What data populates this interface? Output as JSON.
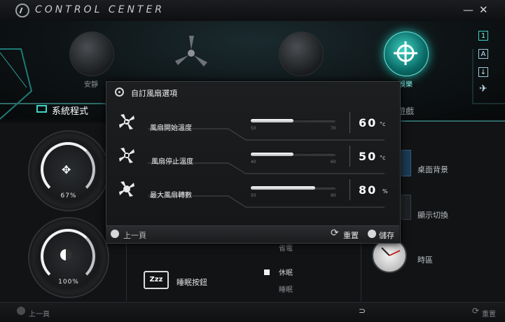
{
  "window": {
    "title": "CONTROL CENTER",
    "minimize": "—",
    "close": "✕"
  },
  "modes": [
    {
      "label": "安靜",
      "icon": "speaker-icon"
    },
    {
      "label": "",
      "icon": "fan-icon"
    },
    {
      "label": "",
      "icon": "speedometer-icon"
    },
    {
      "label": "娛樂",
      "icon": "crosshair-icon"
    }
  ],
  "side_icons": [
    "1",
    "A",
    "↓",
    "✈"
  ],
  "tabs": {
    "system": "系統程式",
    "game": "遊戲"
  },
  "dials": [
    {
      "value": "67%"
    },
    {
      "value": "100%"
    }
  ],
  "right_panel": {
    "wallpaper": "桌面背景",
    "display_switch": "顯示切換",
    "timezone": "時區"
  },
  "sleep": {
    "label": "睡眠按鈕",
    "icon_text": "Zzz",
    "options": [
      "省電",
      "休眠",
      "睡眠"
    ]
  },
  "bottom_bar": {
    "back": "上一頁",
    "reset": "重置"
  },
  "modal": {
    "title": "自訂風扇選項",
    "rows": [
      {
        "label": "風扇開始溫度",
        "min": "50",
        "max": "70",
        "value": "60",
        "unit": "°c",
        "level": 0.5
      },
      {
        "label": "風扇停止溫度",
        "min": "40",
        "max": "60",
        "value": "50",
        "unit": "°c",
        "level": 0.5
      },
      {
        "label": "最大風扇轉數",
        "min": "50",
        "max": "90",
        "value": "80",
        "unit": "%",
        "level": 0.75
      }
    ],
    "footer": {
      "back": "上一頁",
      "reset": "重置",
      "save": "儲存"
    }
  },
  "colors": {
    "accent": "#3fd4c4",
    "background": "#0a0c0e"
  }
}
